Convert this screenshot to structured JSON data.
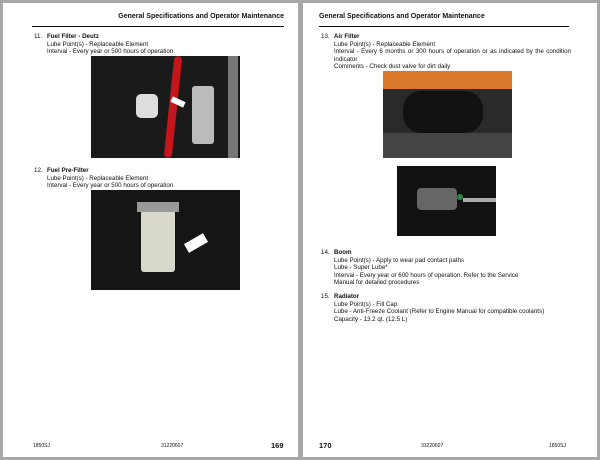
{
  "header": "General Specifications and Operator Maintenance",
  "left": {
    "items": [
      {
        "num": "11.",
        "title": "Fuel Filter - Deutz",
        "lines": [
          "Lube Point(s) - Replaceable Element",
          "Interval - Every year or 500 hours of operation"
        ]
      },
      {
        "num": "12.",
        "title": "Fuel Pre-Filter",
        "lines": [
          "Lube Point(s) - Replaceable Element",
          "Interval - Every year or 500 hours of operation"
        ]
      }
    ],
    "footer": {
      "model": "1850SJ",
      "doc": "31220607",
      "page": "169"
    }
  },
  "right": {
    "items": [
      {
        "num": "13.",
        "title": "Air Filter",
        "lines": [
          "Lube Point(s) - Replaceable Element",
          "Interval - Every 6 months or 300 hours of operation or as indicated by the condition indicator",
          "Comments - Check dust valve for dirt daily"
        ]
      },
      {
        "num": "14.",
        "title": "Boom",
        "lines": [
          "Lube Point(s) - Apply to wear pad contact paths",
          "Lube - Super Lube*",
          "Interval - Every year or 600 hours of operation. Refer to the Service",
          "Manual for detailed procedures"
        ]
      },
      {
        "num": "15.",
        "title": "Radiator",
        "lines": [
          "Lube Point(s) - Fill Cap",
          "Lube - Anti-Freeze Coolant (Refer to Engine Manual for compatible coolants)",
          "Capacity - 13.2 qt. (12.5 L)"
        ]
      }
    ],
    "footer": {
      "model": "1850SJ",
      "doc": "31220607",
      "page": "170"
    }
  }
}
